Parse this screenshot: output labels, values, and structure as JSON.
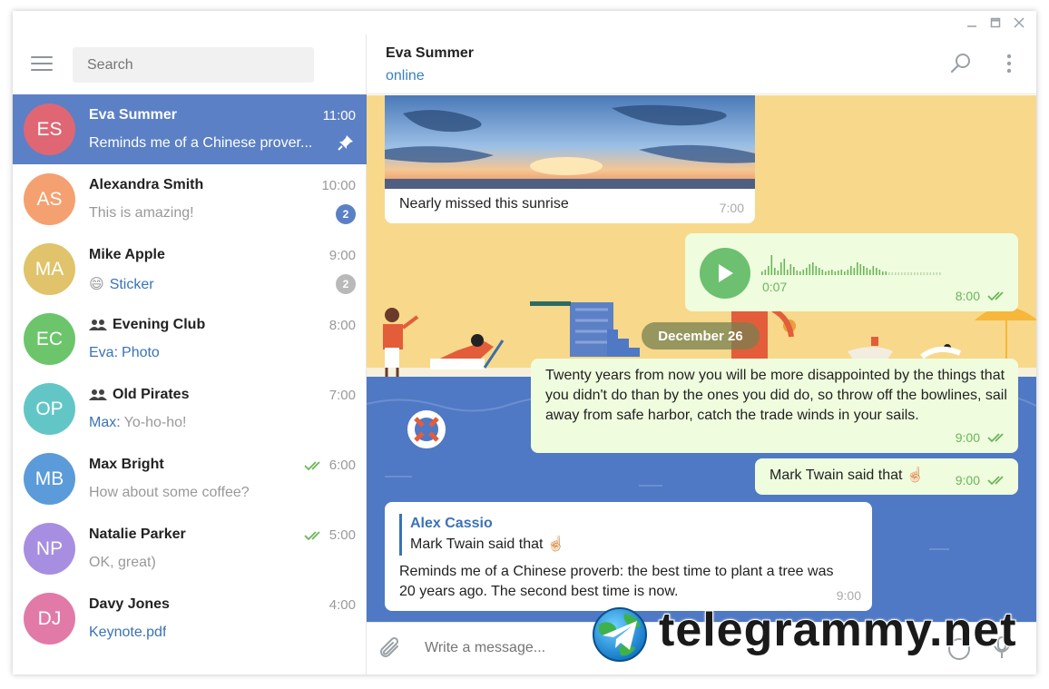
{
  "sidebar": {
    "search_placeholder": "Search",
    "chats": [
      {
        "initials": "ES",
        "name": "Eva Summer",
        "time": "11:00",
        "preview": "Reminds me of a Chinese prover...",
        "color": "#e06674",
        "active": true,
        "pinned": true
      },
      {
        "initials": "AS",
        "name": "Alexandra Smith",
        "time": "10:00",
        "preview": "This is amazing!",
        "color": "#f5a070",
        "badge": "2",
        "badge_color": "#5b80c5"
      },
      {
        "initials": "MA",
        "name": "Mike Apple",
        "time": "9:00",
        "preview_emoji": "😄",
        "preview": "Sticker",
        "color": "#e0c36a",
        "badge": "2",
        "badge_color": "#b9b9b9",
        "preview_blue": true
      },
      {
        "initials": "EC",
        "name": "Evening Club",
        "time": "8:00",
        "preview_prefix": "Eva:",
        "preview": "Photo",
        "color": "#6cc56b",
        "group": true,
        "preview_blue": true
      },
      {
        "initials": "OP",
        "name": "Old Pirates",
        "time": "7:00",
        "preview_prefix": "Max:",
        "preview": "Yo-ho-ho!",
        "color": "#63c6c6",
        "group": true
      },
      {
        "initials": "MB",
        "name": "Max Bright",
        "time": "6:00",
        "preview": "How about some coffee?",
        "color": "#5b9bd9",
        "read": true
      },
      {
        "initials": "NP",
        "name": "Natalie Parker",
        "time": "5:00",
        "preview": "OK, great)",
        "color": "#a88ee0",
        "read": true
      },
      {
        "initials": "DJ",
        "name": "Davy Jones",
        "time": "4:00",
        "preview": "Keynote.pdf",
        "color": "#e27aa8",
        "preview_blue": true
      }
    ]
  },
  "header": {
    "title": "Eva Summer",
    "status": "online"
  },
  "messages": {
    "photo_caption": "Nearly missed this sunrise",
    "photo_time": "7:00",
    "voice_duration": "0:07",
    "voice_time": "8:00",
    "date_badge": "December 26",
    "quote_text": "Twenty years from now you will be more disappointed by the things that you didn't do than by the ones you did do, so throw off the bowlines, sail away from safe harbor, catch the trade winds in your sails.",
    "quote_time": "9:00",
    "twain_text": "Mark Twain said that ☝🏻",
    "twain_time": "9:00",
    "reply_author": "Alex Cassio",
    "reply_quote": "Mark Twain said that ☝🏻",
    "reply_text": "Reminds me of a Chinese proverb: the best time to plant a tree was 20 years ago. The second best time is now.",
    "reply_time": "9:00"
  },
  "composer": {
    "placeholder": "Write a message..."
  },
  "watermark": {
    "text": "telegrammy.net"
  },
  "colors": {
    "accent": "#5b80c5",
    "link": "#3a80c0",
    "outgoing": "#effdde",
    "check": "#6cb55a"
  }
}
